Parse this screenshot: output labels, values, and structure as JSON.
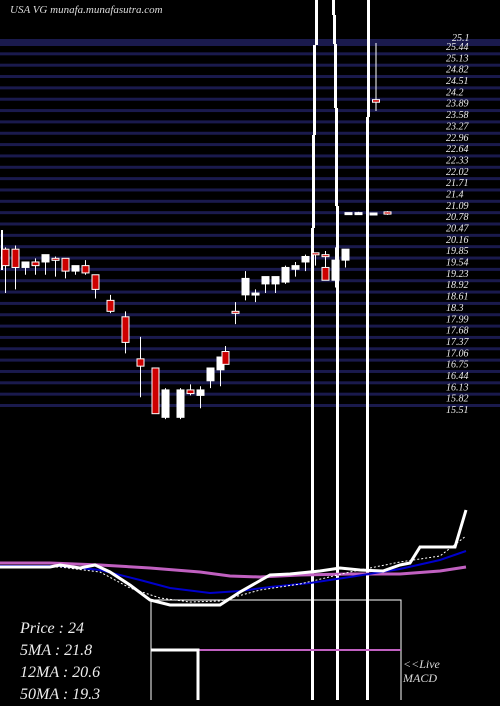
{
  "title": "USA VG munafa.munafasutra.com",
  "legend": {
    "price": "Price   : 24",
    "ma5": "5MA : 21.8",
    "ma12": "12MA : 20.6",
    "ma50": "50MA : 19.3"
  },
  "live_label": "<<Live",
  "macd_label": "MACD",
  "colors": {
    "background": "#000000",
    "grid": "#1a1a4d",
    "up_candle": "#ffffff",
    "down_candle": "#cc0000",
    "ma_fast": "#ffffff",
    "ma_mid": "#0000cc",
    "ma_slow": "#c060c0"
  },
  "chart_data": {
    "type": "candlestick",
    "title": "USA VG munafa.munafasutra.com",
    "y_tick_labels": [
      "25.44",
      "25.13",
      "24.82",
      "24.51",
      "24.2",
      "23.89",
      "23.58",
      "23.27",
      "22.96",
      "22.64",
      "22.33",
      "22.02",
      "21.71",
      "21.4",
      "21.09",
      "20.78",
      "20.47",
      "20.16",
      "19.85",
      "19.54",
      "19.23",
      "18.92",
      "18.61",
      "18.3",
      "17.99",
      "17.68",
      "17.37",
      "17.06",
      "16.75",
      "16.44",
      "16.13",
      "15.82",
      "15.51"
    ],
    "y_top_label": "25.1",
    "ylim": [
      15.51,
      25.44
    ],
    "grid": true,
    "candles": [
      {
        "o": 19.8,
        "h": 19.85,
        "l": 18.6,
        "c": 19.35,
        "dir": "down"
      },
      {
        "o": 19.8,
        "h": 19.9,
        "l": 18.7,
        "c": 19.3,
        "dir": "down"
      },
      {
        "o": 19.3,
        "h": 19.45,
        "l": 19.1,
        "c": 19.45,
        "dir": "up"
      },
      {
        "o": 19.45,
        "h": 19.55,
        "l": 19.1,
        "c": 19.35,
        "dir": "down"
      },
      {
        "o": 19.45,
        "h": 19.65,
        "l": 19.1,
        "c": 19.65,
        "dir": "up"
      },
      {
        "o": 19.55,
        "h": 19.6,
        "l": 19.05,
        "c": 19.5,
        "dir": "down"
      },
      {
        "o": 19.55,
        "h": 19.55,
        "l": 19.0,
        "c": 19.2,
        "dir": "down"
      },
      {
        "o": 19.2,
        "h": 19.35,
        "l": 19.1,
        "c": 19.35,
        "dir": "up"
      },
      {
        "o": 19.35,
        "h": 19.5,
        "l": 19.1,
        "c": 19.15,
        "dir": "down"
      },
      {
        "o": 19.1,
        "h": 19.1,
        "l": 18.45,
        "c": 18.7,
        "dir": "down"
      },
      {
        "o": 18.4,
        "h": 18.55,
        "l": 18.05,
        "c": 18.1,
        "dir": "down"
      },
      {
        "o": 17.95,
        "h": 18.1,
        "l": 16.95,
        "c": 17.25,
        "dir": "down"
      },
      {
        "o": 16.8,
        "h": 17.4,
        "l": 15.75,
        "c": 16.6,
        "dir": "down"
      },
      {
        "o": 16.55,
        "h": 16.55,
        "l": 15.3,
        "c": 15.3,
        "dir": "down"
      },
      {
        "o": 15.5,
        "h": 15.65,
        "l": 15.3,
        "c": 15.7,
        "dir": "up"
      },
      {
        "o": 15.2,
        "h": 16.0,
        "l": 15.15,
        "c": 15.95,
        "dir": "up"
      },
      {
        "o": 15.2,
        "h": 16.0,
        "l": 15.15,
        "c": 15.95,
        "dir": "up"
      },
      {
        "o": 15.95,
        "h": 16.1,
        "l": 15.8,
        "c": 15.85,
        "dir": "down"
      },
      {
        "o": 15.8,
        "h": 16.05,
        "l": 15.45,
        "c": 15.95,
        "dir": "up"
      },
      {
        "o": 16.2,
        "h": 16.5,
        "l": 16.0,
        "c": 16.55,
        "dir": "up"
      },
      {
        "o": 16.5,
        "h": 16.8,
        "l": 16.05,
        "c": 16.85,
        "dir": "up"
      },
      {
        "o": 17.0,
        "h": 17.15,
        "l": 16.75,
        "c": 16.65,
        "dir": "down"
      },
      {
        "o": 18.1,
        "h": 18.35,
        "l": 17.75,
        "c": 18.05,
        "dir": "down"
      },
      {
        "o": 18.55,
        "h": 19.2,
        "l": 18.4,
        "c": 19.0,
        "dir": "up"
      },
      {
        "o": 18.55,
        "h": 18.7,
        "l": 18.35,
        "c": 18.6,
        "dir": "up"
      },
      {
        "o": 18.85,
        "h": 19.05,
        "l": 18.6,
        "c": 19.05,
        "dir": "up"
      },
      {
        "o": 18.85,
        "h": 19.05,
        "l": 18.6,
        "c": 19.05,
        "dir": "up"
      },
      {
        "o": 18.9,
        "h": 19.35,
        "l": 18.85,
        "c": 19.3,
        "dir": "up"
      },
      {
        "o": 19.25,
        "h": 19.45,
        "l": 19.05,
        "c": 19.35,
        "dir": "up"
      },
      {
        "o": 19.45,
        "h": 19.65,
        "l": 19.2,
        "c": 19.6,
        "dir": "up"
      },
      {
        "o": 19.7,
        "h": 19.7,
        "l": 19.35,
        "c": 19.65,
        "dir": "down"
      },
      {
        "o": 19.65,
        "h": 19.75,
        "l": 19.35,
        "c": 19.6,
        "dir": "down"
      },
      {
        "o": 19.3,
        "h": 19.4,
        "l": 18.95,
        "c": 18.95,
        "dir": "down"
      },
      {
        "o": 18.95,
        "h": 19.85,
        "l": 18.75,
        "c": 19.5,
        "dir": "up"
      },
      {
        "o": 19.5,
        "h": 19.75,
        "l": 19.3,
        "c": 19.8,
        "dir": "up"
      },
      {
        "o": 20.8,
        "h": 20.8,
        "l": 20.75,
        "c": 20.78,
        "dir": "up"
      },
      {
        "o": 20.8,
        "h": 20.82,
        "l": 20.75,
        "c": 20.78,
        "dir": "up"
      },
      {
        "o": 20.78,
        "h": 20.8,
        "l": 20.76,
        "c": 20.79,
        "dir": "up"
      },
      {
        "o": 20.82,
        "h": 20.84,
        "l": 20.74,
        "c": 20.76,
        "dir": "down"
      },
      {
        "o": 23.89,
        "h": 25.44,
        "l": 23.58,
        "c": 23.82,
        "dir": "down"
      }
    ],
    "moving_averages": {
      "names": [
        "5MA",
        "12MA",
        "50MA"
      ],
      "latest": [
        21.8,
        20.6,
        19.3
      ]
    },
    "macd_label": "MACD"
  }
}
